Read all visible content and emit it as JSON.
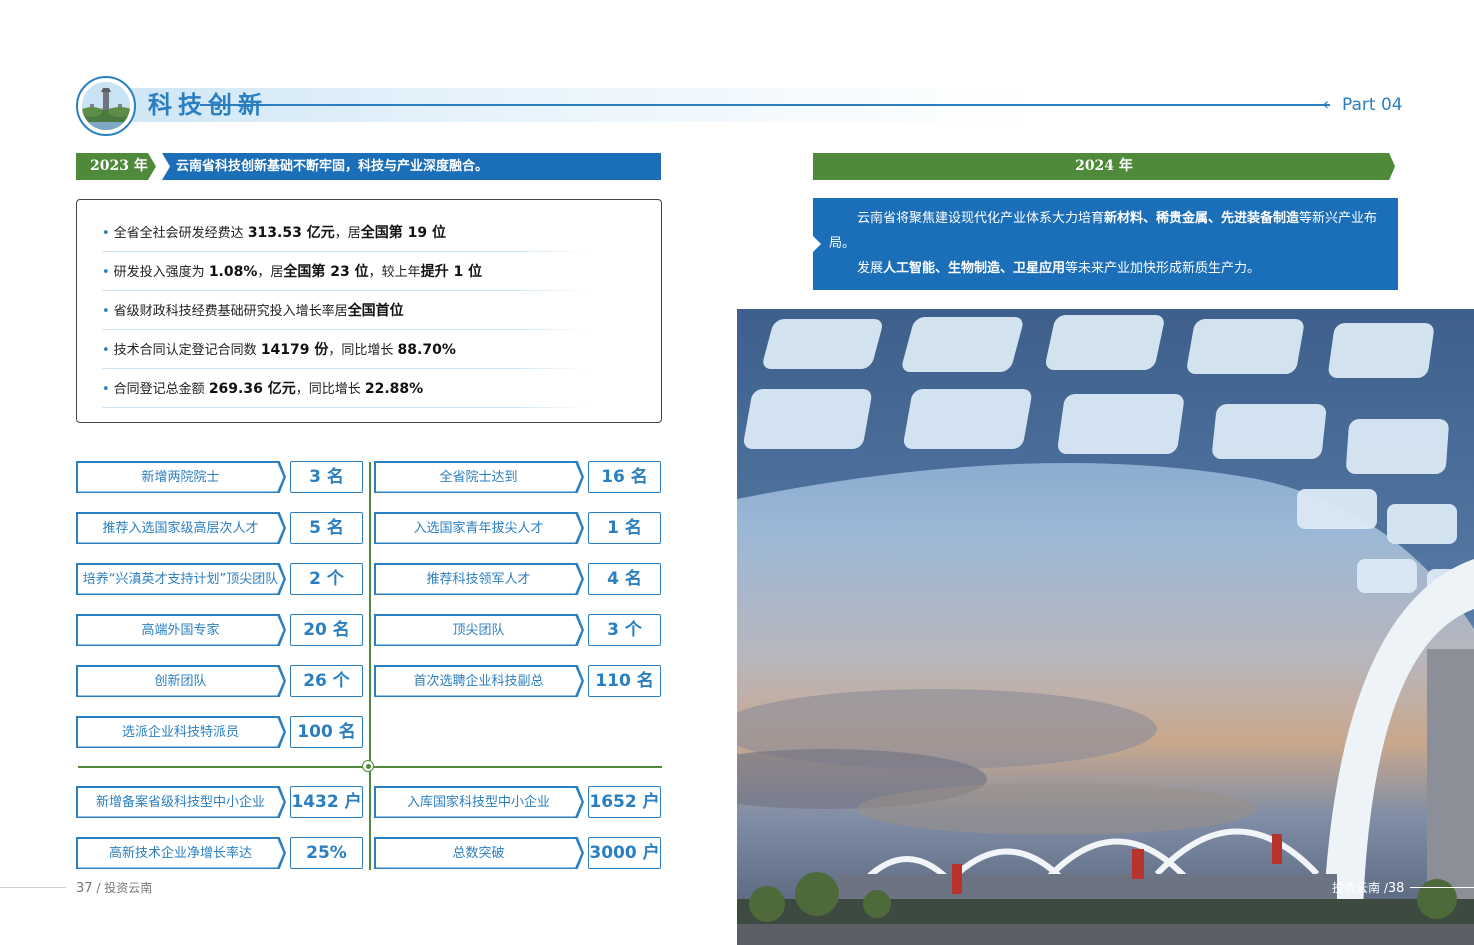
{
  "header": {
    "section_title": "科技创新",
    "part_label": "Part 04"
  },
  "y2023": {
    "tag": "2023 年",
    "banner": "云南省科技创新基础不断牢固，科技与产业深度融合。",
    "stats": [
      {
        "pre": "全省全社会研发经费达 ",
        "b1": "313.53 亿元",
        "mid": "，居",
        "b2": "全国第 19 位",
        "mid2": "",
        "b3": "",
        "post": ""
      },
      {
        "pre": "研发投入强度为 ",
        "b1": "1.08%",
        "mid": "，居",
        "b2": "全国第 23 位",
        "mid2": "，较上年",
        "b3": "提升 1 位",
        "post": ""
      },
      {
        "pre": "省级财政科技经费基础研究投入增长率居",
        "b1": "全国首位",
        "mid": "",
        "b2": "",
        "mid2": "",
        "b3": "",
        "post": ""
      },
      {
        "pre": "技术合同认定登记合同数 ",
        "b1": "14179 份",
        "mid": "，同比增长 ",
        "b2": "88.70%",
        "mid2": "",
        "b3": "",
        "post": ""
      },
      {
        "pre": "合同登记总金额 ",
        "b1": "269.36 亿元",
        "mid": "，同比增长 ",
        "b2": "22.88%",
        "mid2": "",
        "b3": "",
        "post": ""
      }
    ]
  },
  "grid": {
    "left": [
      {
        "label": "新增两院院士",
        "value": "3 名"
      },
      {
        "label": "推荐入选国家级高层次人才",
        "value": "5 名"
      },
      {
        "label": "培养“兴滇英才支持计划”顶尖团队",
        "value": "2 个"
      },
      {
        "label": "高端外国专家",
        "value": "20 名"
      },
      {
        "label": "创新团队",
        "value": "26 个"
      },
      {
        "label": "选派企业科技特派员",
        "value": "100 名"
      }
    ],
    "right": [
      {
        "label": "全省院士达到",
        "value": "16 名"
      },
      {
        "label": "入选国家青年拔尖人才",
        "value": "1 名"
      },
      {
        "label": "推荐科技领军人才",
        "value": "4 名"
      },
      {
        "label": "顶尖团队",
        "value": "3 个"
      },
      {
        "label": "首次选聘企业科技副总",
        "value": "110 名"
      }
    ],
    "bottom_left": [
      {
        "label": "新增备案省级科技型中小企业",
        "value": "1432 户"
      },
      {
        "label": "高新技术企业净增长率达",
        "value": "25%"
      }
    ],
    "bottom_right": [
      {
        "label": "入库国家科技型中小企业",
        "value": "1652 户"
      },
      {
        "label": "总数突破",
        "value": "3000 户"
      }
    ]
  },
  "y2024": {
    "tag": "2024 年",
    "p1_a": "云南省将聚焦建设现代化产业体系大力培育",
    "p1_b": "新材料、稀贵金属、先进装备制造",
    "p1_c": "等新兴产业布局。",
    "p2_a": "发展",
    "p2_b": "人工智能、生物制造、卫星应用",
    "p2_c": "等未来产业加快形成新质生产力。"
  },
  "footer": {
    "left_num": "37",
    "left_text": " / 投资云南",
    "right_text": "投资云南 /",
    "right_num": "38"
  },
  "colors": {
    "primary_blue": "#2b7fc1",
    "banner_blue": "#1b6fb8",
    "green": "#4e8a3a"
  }
}
